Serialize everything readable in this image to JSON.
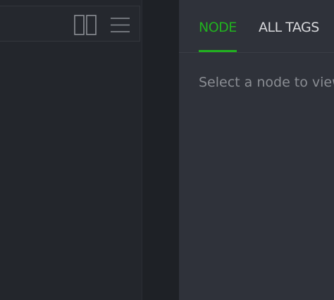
{
  "left_panel": {
    "toolbar": {
      "split_view_icon": "split-view-icon",
      "menu_icon": "hamburger-menu-icon"
    }
  },
  "detail_panel": {
    "tabs": [
      {
        "label": "NODE",
        "active": true
      },
      {
        "label": "ALL TAGS",
        "active": false
      }
    ],
    "placeholder": "Select a node to view"
  },
  "colors": {
    "accent": "#21b21f",
    "panel_bg": "#2f323a",
    "tree_bg": "#23262c",
    "hint_text": "#8a8d93"
  }
}
